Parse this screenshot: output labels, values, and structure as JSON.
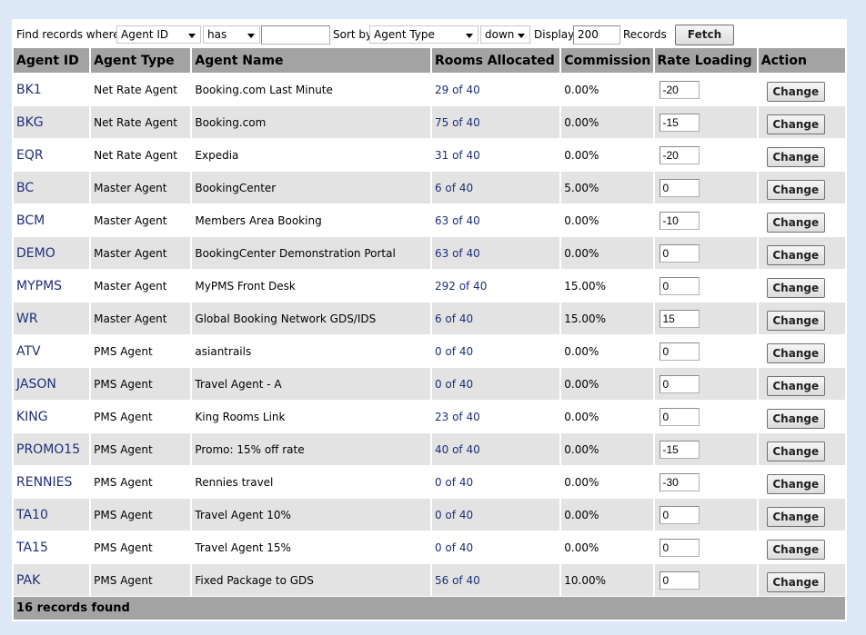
{
  "filter": {
    "find_label": "Find records where",
    "field": "Agent ID",
    "operator": "has",
    "value": "",
    "sort_label": "Sort by",
    "sort_field": "Agent Type",
    "sort_dir": "down",
    "display_label": "Display",
    "display_count": "200",
    "records_label": "Records",
    "fetch_label": "Fetch"
  },
  "columns": [
    "Agent ID",
    "Agent Type",
    "Agent Name",
    "Rooms Allocated",
    "Commission",
    "Rate Loading",
    "Action"
  ],
  "rows": [
    {
      "id": "BK1",
      "type": "Net Rate Agent",
      "name": "Booking.com Last Minute",
      "rooms": "29 of 40",
      "commission": "0.00%",
      "rate": "-20"
    },
    {
      "id": "BKG",
      "type": "Net Rate Agent",
      "name": "Booking.com",
      "rooms": "75 of 40",
      "commission": "0.00%",
      "rate": "-15"
    },
    {
      "id": "EQR",
      "type": "Net Rate Agent",
      "name": "Expedia",
      "rooms": "31 of 40",
      "commission": "0.00%",
      "rate": "-20"
    },
    {
      "id": "BC",
      "type": "Master Agent",
      "name": "BookingCenter",
      "rooms": "6 of 40",
      "commission": "5.00%",
      "rate": "0"
    },
    {
      "id": "BCM",
      "type": "Master Agent",
      "name": "Members Area Booking",
      "rooms": "63 of 40",
      "commission": "0.00%",
      "rate": "-10"
    },
    {
      "id": "DEMO",
      "type": "Master Agent",
      "name": "BookingCenter Demonstration Portal",
      "rooms": "63 of 40",
      "commission": "0.00%",
      "rate": "0"
    },
    {
      "id": "MYPMS",
      "type": "Master Agent",
      "name": "MyPMS Front Desk",
      "rooms": "292 of 40",
      "commission": "15.00%",
      "rate": "0"
    },
    {
      "id": "WR",
      "type": "Master Agent",
      "name": "Global Booking Network GDS/IDS",
      "rooms": "6 of 40",
      "commission": "15.00%",
      "rate": "15"
    },
    {
      "id": "ATV",
      "type": "PMS Agent",
      "name": "asiantrails",
      "rooms": "0 of 40",
      "commission": "0.00%",
      "rate": "0"
    },
    {
      "id": "JASON",
      "type": "PMS Agent",
      "name": "Travel Agent - A",
      "rooms": "0 of 40",
      "commission": "0.00%",
      "rate": "0"
    },
    {
      "id": "KING",
      "type": "PMS Agent",
      "name": "King Rooms Link",
      "rooms": "23 of 40",
      "commission": "0.00%",
      "rate": "0"
    },
    {
      "id": "PROMO15",
      "type": "PMS Agent",
      "name": "Promo: 15% off rate",
      "rooms": "40 of 40",
      "commission": "0.00%",
      "rate": "-15"
    },
    {
      "id": "RENNIES",
      "type": "PMS Agent",
      "name": "Rennies travel",
      "rooms": "0 of 40",
      "commission": "0.00%",
      "rate": "-30"
    },
    {
      "id": "TA10",
      "type": "PMS Agent",
      "name": "Travel Agent 10%",
      "rooms": "0 of 40",
      "commission": "0.00%",
      "rate": "0"
    },
    {
      "id": "TA15",
      "type": "PMS Agent",
      "name": "Travel Agent 15%",
      "rooms": "0 of 40",
      "commission": "0.00%",
      "rate": "0"
    },
    {
      "id": "PAK",
      "type": "PMS Agent",
      "name": "Fixed Package to GDS",
      "rooms": "56 of 40",
      "commission": "10.00%",
      "rate": "0"
    }
  ],
  "change_label": "Change",
  "footer": "16 records found",
  "colors": {
    "page_bg": "#dde8f7",
    "header_bg": "#a3a3a3",
    "even_row_bg": "#e3e3e3",
    "link": "#1f2f7a"
  }
}
